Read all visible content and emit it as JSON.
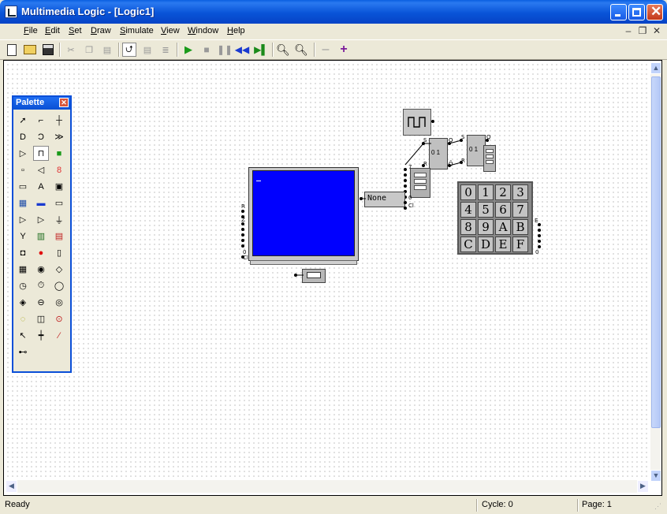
{
  "window": {
    "title": "Multimedia Logic - [Logic1]"
  },
  "menu": {
    "items": [
      {
        "label": "File",
        "u": "F",
        "rest": "ile"
      },
      {
        "label": "Edit",
        "u": "E",
        "rest": "dit"
      },
      {
        "label": "Set",
        "u": "S",
        "rest": "et"
      },
      {
        "label": "Draw",
        "u": "D",
        "rest": "raw"
      },
      {
        "label": "Simulate",
        "u": "S",
        "rest": "imulate"
      },
      {
        "label": "View",
        "u": "V",
        "rest": "iew"
      },
      {
        "label": "Window",
        "u": "W",
        "rest": "indow"
      },
      {
        "label": "Help",
        "u": "H",
        "rest": "elp"
      }
    ]
  },
  "toolbar": {
    "icons": [
      "new-icon",
      "open-icon",
      "save-icon",
      "cut-icon",
      "copy-icon",
      "paste-icon",
      "draw-mode-icon",
      "run-mode-icon",
      "trace-icon",
      "run-icon",
      "stop-icon",
      "pause-icon",
      "step-back-icon",
      "step-icon",
      "zoom-out-icon",
      "zoom-in-icon",
      "minus-icon",
      "plus-icon"
    ]
  },
  "palette": {
    "title": "Palette",
    "icons": [
      "pointer-tool-icon",
      "wire-tool-icon",
      "junction-icon",
      "and-gate-icon",
      "or-gate-icon",
      "xor-gate-icon",
      "buffer-icon",
      "clock-icon",
      "led-icon",
      "switch-icon",
      "speaker-icon",
      "seven-segment-icon",
      "bitmap-icon",
      "text-icon",
      "button-icon",
      "keyboard-icon",
      "screen-icon",
      "serial-icon",
      "tag-icon",
      "flag-icon",
      "ground-icon",
      "antenna-icon",
      "chip-icon",
      "timer-icon",
      "sound-icon",
      "red-led-icon",
      "memory-icon",
      "flipflop-icon",
      "dot-icon",
      "counter-icon",
      "register-icon",
      "hexdisplay-icon",
      "cup-icon",
      "cube-icon",
      "alarm-clock-icon",
      "stopwatch-icon",
      "bulb-icon",
      "printer-icon",
      "eye-icon",
      "arrow-icon",
      "adjust-icon",
      "brush-icon",
      "bicycle-icon"
    ],
    "glyphs": [
      "➚",
      "⌐",
      "┼",
      "D",
      "Ɔ",
      "≫",
      "▷",
      "⊓",
      "■",
      "▫",
      "◁",
      "8",
      "▭",
      "A",
      "▣",
      "▦",
      "▬",
      "▭",
      "▷",
      "▷",
      "⏚",
      "Y",
      "▥",
      "▤",
      "◘",
      "●",
      "▯",
      "▦",
      "◉",
      "◇",
      "◷",
      "⏱",
      "◯",
      "◈",
      "⊖",
      "◎",
      "◌",
      "◫",
      "⊙",
      "↖",
      "┿",
      "⁄",
      "⊷"
    ],
    "glyph_colors": [
      "#000",
      "#000",
      "#000",
      "#000",
      "#000",
      "#000",
      "#000",
      "#000",
      "#1a9a1a",
      "#000",
      "#000",
      "#e03030",
      "#000",
      "#000",
      "#000",
      "#1a4aa8",
      "#1a3ad0",
      "#000",
      "#000",
      "#000",
      "#000",
      "#000",
      "#1a6a1a",
      "#c02020",
      "#000",
      "#e01010",
      "#000",
      "#000",
      "#000",
      "#000",
      "#000",
      "#000",
      "#000",
      "#000",
      "#000",
      "#000",
      "#a0a000",
      "#000",
      "#c02020",
      "#000",
      "#000",
      "#c02020",
      "#000"
    ]
  },
  "canvas": {
    "ascii_display_value": "None",
    "keypad_keys": [
      "0",
      "1",
      "2",
      "3",
      "4",
      "5",
      "6",
      "7",
      "8",
      "9",
      "A",
      "B",
      "C",
      "D",
      "E",
      "F"
    ],
    "flipflop_label": "0 1",
    "screen_color": "#0000ff"
  },
  "status": {
    "text": "Ready",
    "cycle": "Cycle: 0",
    "page": "Page: 1"
  }
}
